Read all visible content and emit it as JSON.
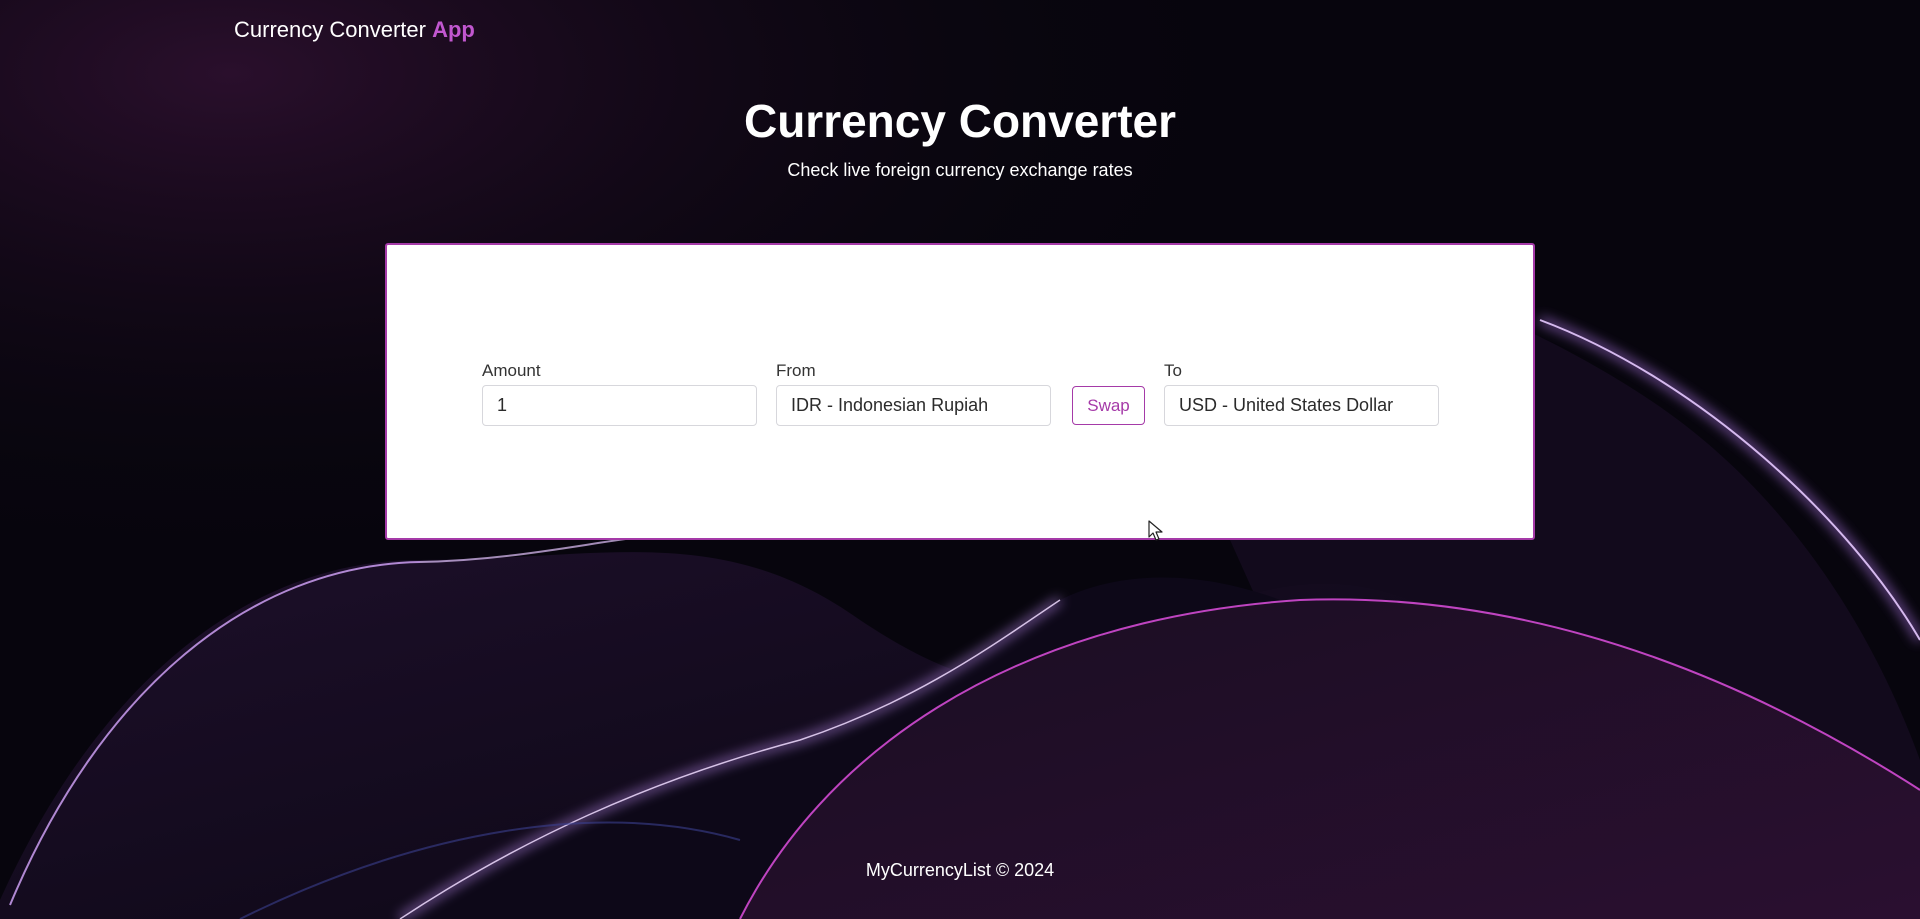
{
  "nav": {
    "brand_main": "Currency Converter",
    "brand_accent": "App"
  },
  "hero": {
    "title": "Currency Converter",
    "subtitle": "Check live foreign currency exchange rates"
  },
  "converter": {
    "amount_label": "Amount",
    "amount_value": "1",
    "from_label": "From",
    "from_value": "IDR - Indonesian Rupiah",
    "swap_label": "Swap",
    "to_label": "To",
    "to_value": "USD - United States Dollar"
  },
  "footer": {
    "text": "MyCurrencyList © 2024"
  },
  "colors": {
    "accent": "#a53aa8",
    "brand_accent": "#c157cf",
    "background": "#07050d"
  }
}
